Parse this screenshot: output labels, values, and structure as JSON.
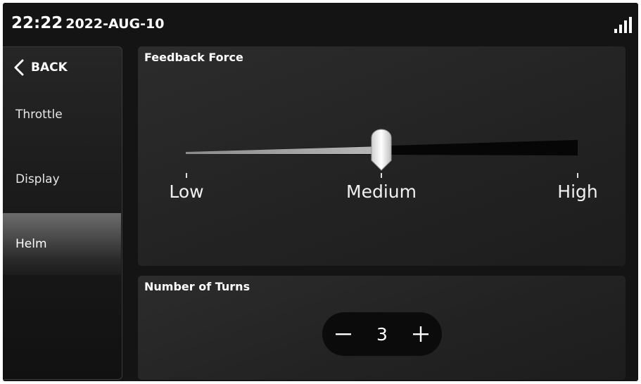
{
  "status": {
    "time": "22:22",
    "date": "2022-AUG-10",
    "signal_icon": "signal-bars-icon"
  },
  "sidebar": {
    "back_label": "BACK",
    "items": [
      {
        "label": "Throttle"
      },
      {
        "label": "Display"
      },
      {
        "label": "Helm",
        "active": true
      }
    ]
  },
  "feedback": {
    "title": "Feedback Force",
    "levels": [
      "Low",
      "Medium",
      "High"
    ],
    "selected": "Medium",
    "value_fraction": 0.5
  },
  "turns": {
    "title": "Number of Turns",
    "value": "3",
    "minus_icon": "minus-icon",
    "plus_icon": "plus-icon"
  }
}
